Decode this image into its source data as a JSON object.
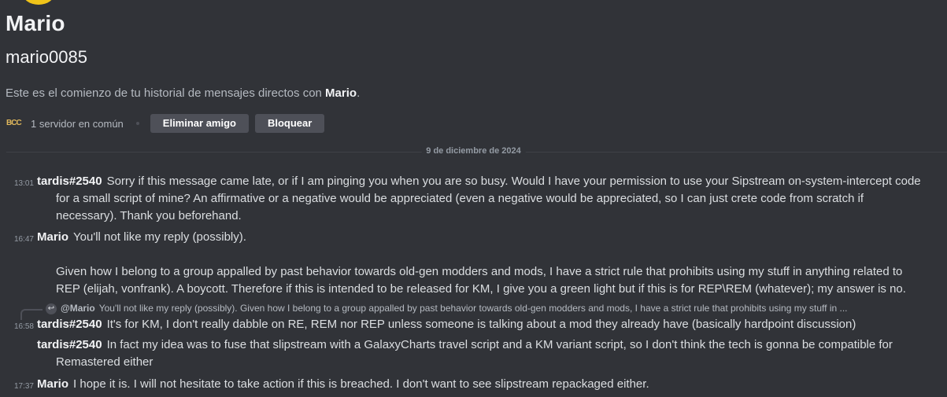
{
  "profile": {
    "name": "Mario",
    "handle": "mario0085",
    "intro_prefix": "Este es el comienzo de tu historial de mensajes directos con ",
    "intro_name": "Mario",
    "intro_suffix": ".",
    "server_icon_text": "BCC",
    "mutual_servers": "1 servidor en común",
    "remove_friend": "Eliminar amigo",
    "block": "Bloquear",
    "avatar_color": "#f0c419"
  },
  "divider": {
    "date": "9 de diciembre de 2024"
  },
  "messages": [
    {
      "time": "13:01",
      "author": "tardis#2540",
      "lines": [
        "Sorry if this message came late, or if I am pinging you when you are so busy. Would I have your permission to use your Sipstream on-system-intercept code",
        "for a small script of mine? An affirmative or a negative would be appreciated (even a negative would be appreciated, so I can just crete code from scratch if",
        "necessary). Thank you beforehand."
      ]
    },
    {
      "time": "16:47",
      "author": "Mario",
      "lines": [
        "You'll not like my reply (possibly).",
        "",
        "Given how I belong to a group appalled by past behavior towards old-gen modders and mods, I have a strict rule that prohibits using my stuff in anything related to",
        "REP (elijah, vonfrank). A boycott. Therefore if this is intended to be released for KM, I give you a green light but if this is for REP\\REM (whatever); my answer is no."
      ]
    },
    {
      "reply": {
        "mention": "@Mario",
        "text": "You'll not like my reply (possibly).  Given how I belong to a group appalled by past behavior towards old-gen modders and mods, I have a strict rule that prohibits using my stuff in ..."
      },
      "time": "16:58",
      "author": "tardis#2540",
      "lines": [
        "It's for KM, I don't really dabble on RE, REM nor REP unless someone is talking about a mod they already have (basically hardpoint discussion)"
      ]
    },
    {
      "time": "",
      "author": "tardis#2540",
      "lines": [
        "In fact my idea was to fuse that slipstream with a GalaxyCharts travel script and a KM variant script, so I don't think the tech is gonna be compatible for",
        "Remastered either"
      ]
    },
    {
      "time": "17:37",
      "author": "Mario",
      "lines": [
        "I hope it is. I will not hesitate to take action if this is breached. I don't want to see slipstream repackaged either."
      ]
    }
  ]
}
